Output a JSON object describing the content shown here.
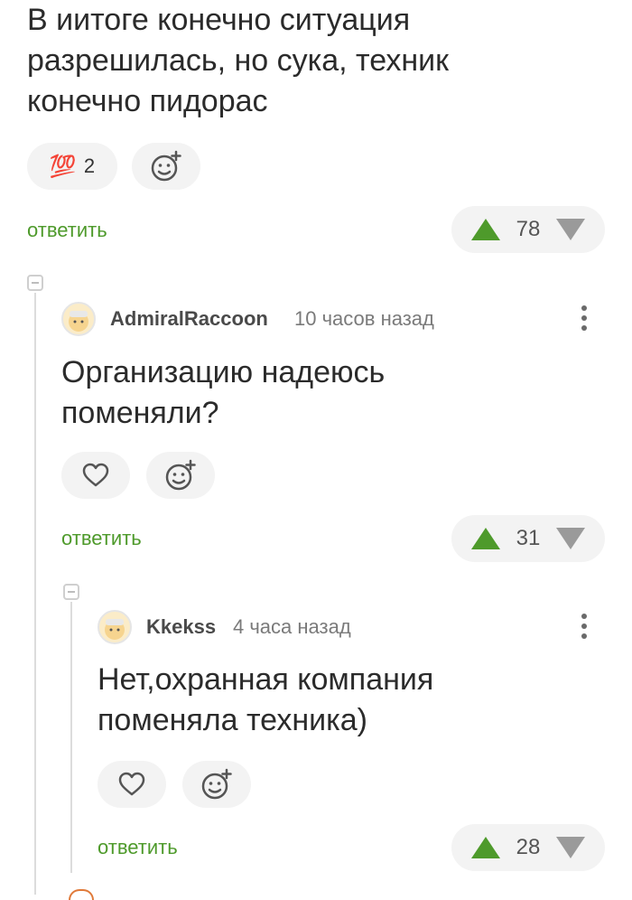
{
  "top_comment": {
    "text_lines": [
      "В иитоге конечно ситуация",
      "разрешилась, но сука, техник",
      "конечно пидорас"
    ],
    "reaction_emoji": "💯",
    "reaction_count": "2",
    "reply_label": "ответить",
    "score": "78"
  },
  "comment_1": {
    "author": "AdmiralRaccoon",
    "time": "10 часов назад",
    "text_lines": [
      "Организацию надеюсь",
      "поменяли?"
    ],
    "reply_label": "ответить",
    "score": "31"
  },
  "comment_2": {
    "author": "Kkekss",
    "time": "4 часа назад",
    "text_lines": [
      "Нет,охранная компания",
      "поменяла техника)"
    ],
    "reply_label": "ответить",
    "score": "28"
  },
  "colors": {
    "accent": "#4e9a2b",
    "downvote": "#9a9a9a",
    "pill_bg": "#f3f3f3"
  },
  "icons": [
    "hundred-points-icon",
    "add-reaction-icon",
    "heart-icon",
    "more-vertical-icon",
    "upvote-icon",
    "downvote-icon",
    "collapse-icon"
  ]
}
